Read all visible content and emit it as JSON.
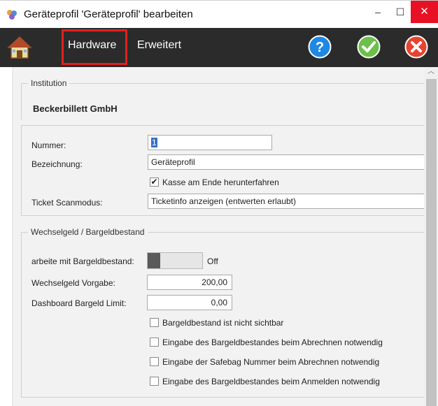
{
  "window": {
    "title": "Geräteprofil 'Geräteprofil' bearbeiten",
    "minimize": "–",
    "maximize": "☐",
    "close": "✕"
  },
  "toolbar": {
    "tab_hardware": "Hardware",
    "tab_extended": "Erweitert"
  },
  "institution": {
    "legend": "Institution",
    "name": "Beckerbillett GmbH"
  },
  "profile": {
    "number_label": "Nummer:",
    "number_value": "1",
    "name_label": "Bezeichnung:",
    "name_value": "Geräteprofil",
    "shutdown_label": "Kasse am Ende herunterfahren",
    "shutdown_checked": true,
    "scanmode_label": "Ticket Scanmodus:",
    "scanmode_value": "Ticketinfo anzeigen (entwerten erlaubt)"
  },
  "cash": {
    "legend": "Wechselgeld / Bargeldbestand",
    "work_with_cash_label": "arbeite mit Bargeldbestand:",
    "work_with_cash_state": "Off",
    "change_default_label": "Wechselgeld Vorgabe:",
    "change_default_value": "200,00",
    "dashboard_limit_label": "Dashboard Bargeld Limit:",
    "dashboard_limit_value": "0,00",
    "options": [
      {
        "label": "Bargeldbestand ist nicht sichtbar",
        "checked": false
      },
      {
        "label": "Eingabe des Bargeldbestandes beim Abrechnen notwendig",
        "checked": false
      },
      {
        "label": "Eingabe der Safebag Nummer beim Abrechnen notwendig",
        "checked": false
      },
      {
        "label": "Eingabe des Bargeldbestandes beim Anmelden notwendig",
        "checked": false
      }
    ]
  },
  "icons": {
    "home": "home-icon",
    "help": "help-icon",
    "ok": "confirm-icon",
    "cancel": "cancel-icon"
  },
  "colors": {
    "toolbar_bg": "#2b2b2b",
    "close_button": "#e81123",
    "help_blue": "#1e88e5",
    "ok_green": "#6cc04a",
    "cancel_red": "#e8432e",
    "tab_highlight": "#e02020"
  }
}
